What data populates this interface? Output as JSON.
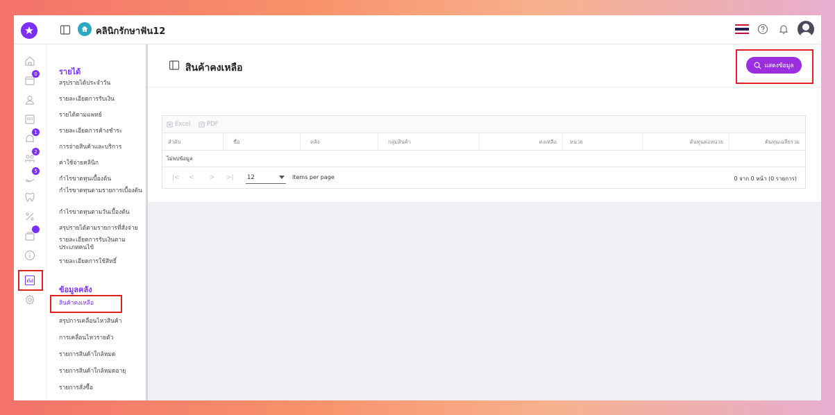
{
  "header": {
    "clinic_name": "คลินิกรักษาฟัน12"
  },
  "rail": {
    "badges": [
      "0",
      "1",
      "2",
      "5"
    ]
  },
  "menu": {
    "section_income": "รายได้",
    "income_items": [
      "สรุปรายได้ประจำวัน",
      "รายละเอียดการรับเงิน",
      "รายได้ตามแพทย์",
      "รายละเอียดการค้างชำระ",
      "การจ่ายสินค้าและบริการ",
      "ค่าใช้จ่ายคลินิก",
      "กำไรขาดทุนเบื้องต้น",
      "กำไรขาดทุนตามรายการเบื้องต้น",
      "กำไรขาดทุนตามวันเบื้องต้น",
      "สรุปรายได้ตามรายการที่สั่งจ่าย",
      "รายละเอียดการรับเงินตามประเภทคนไข้",
      "รายละเอียดการใช้สิทธิ์"
    ],
    "section_inventory": "ข้อมูลคลัง",
    "inventory_items": [
      "สินค้าคงเหลือ",
      "สรุปการเคลื่อนไหวสินค้า",
      "การเคลื่อนไหวรายตัว",
      "รายการสินค้าใกล้หมด",
      "รายการสินค้าใกล้หมดอายุ",
      "รายการสั่งซื้อ"
    ]
  },
  "page": {
    "title": "สินค้าคงเหลือ",
    "show_button": "แสดงข้อมูล"
  },
  "table": {
    "toolbar": {
      "excel": "Excel",
      "pdf": "PDF"
    },
    "columns": [
      "ลำดับ",
      "ชื่อ",
      "คลัง",
      "กลุ่มสินค้า",
      "คงเหลือ",
      "หน่วย",
      "ต้นทุนต่อหน่วย",
      "ต้นทุนเฉลี่ยรวม"
    ],
    "empty": "ไม่พบข้อมูล",
    "pager": {
      "per_page": "12",
      "per_page_label": "Items per page",
      "range": "0 จาก 0 หน้า (0 รายการ)"
    }
  },
  "colors": {
    "accent": "#7b2ff7",
    "button": "#9b2fe0",
    "highlight": "#e02020"
  }
}
